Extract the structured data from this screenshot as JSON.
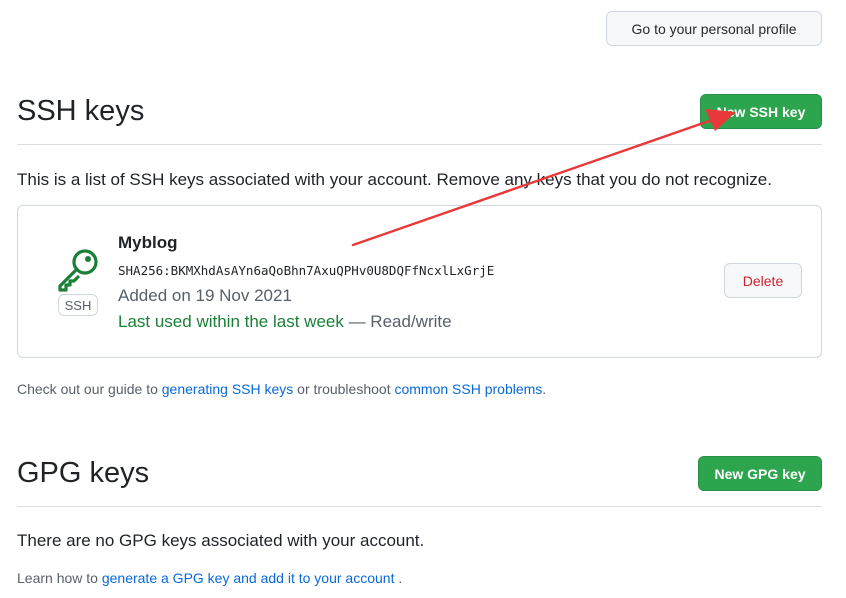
{
  "header": {
    "profile_button_label": "Go to your personal profile"
  },
  "ssh": {
    "title": "SSH keys",
    "new_button_label": "New SSH key",
    "intro": "This is a list of SSH keys associated with your account. Remove any keys that you do not recognize.",
    "keys": [
      {
        "badge": "SSH",
        "name": "Myblog",
        "fingerprint": "SHA256:BKMXhdAsAYn6aQoBhn7AxuQPHv0U8DQFfNcxlLxGrjE",
        "added": "Added on 19 Nov 2021",
        "last_used": "Last used within the last week",
        "access": " — Read/write",
        "delete_label": "Delete"
      }
    ],
    "guide": {
      "prefix": "Check out our guide to ",
      "link1": "generating SSH keys",
      "middle": " or troubleshoot ",
      "link2": "common SSH problems",
      "suffix": "."
    }
  },
  "gpg": {
    "title": "GPG keys",
    "new_button_label": "New GPG key",
    "intro": "There are no GPG keys associated with your account.",
    "learn": {
      "prefix": "Learn how to ",
      "link": "generate a GPG key and add it to your account",
      "suffix": " ."
    }
  },
  "colors": {
    "primary_green": "#2da44e",
    "danger_red": "#cf222e",
    "link_blue": "#0969da",
    "key_icon_green": "#1a7f37",
    "annotation_red": "#e8393a"
  },
  "icons": {
    "key": "key-icon",
    "annotation": "arrow-annotation"
  }
}
